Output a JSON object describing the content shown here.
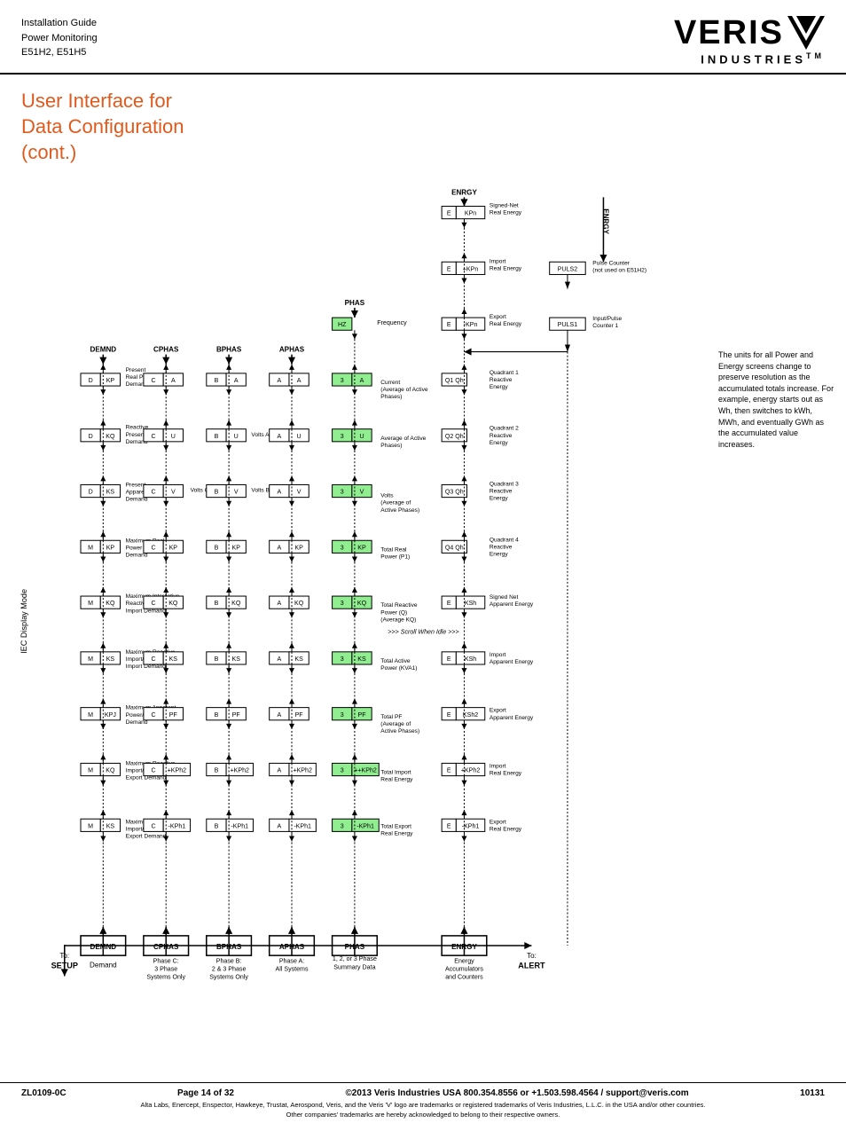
{
  "header": {
    "doc_line1": "Installation Guide",
    "doc_line2": "Power Monitoring",
    "doc_line3": "E51H2, E51H5",
    "logo_name": "VERIS",
    "logo_sub": "INDUSTRIES",
    "logo_tm": "TM"
  },
  "page_title_line1": "User Interface for",
  "page_title_line2": "Data Configuration",
  "page_title_line3": "(cont.)",
  "right_note": "The units for all Power and Energy screens change to preserve resolution as the accumulated totals increase. For example, energy starts out as Wh, then switches to kWh, MWh, and eventually GWh as the accumulated value increases.",
  "footer": {
    "doc_number": "ZL0109-0C",
    "page_info": "Page 14 of 32",
    "copyright": "©2013 Veris Industries   USA 800.354.8556 or +1.503.598.4564 / support@veris.com",
    "part_number": "10131",
    "trademark_line1": "Alta Labs, Enercept, Enspector, Hawkeye, Trustat, Aerospond, Veris, and the Veris 'V' logo are trademarks or registered trademarks of Veris Industries, L.L.C. in the USA and/or other countries.",
    "trademark_line2": "Other companies' trademarks are hereby acknowledged to belong to their respective owners."
  }
}
